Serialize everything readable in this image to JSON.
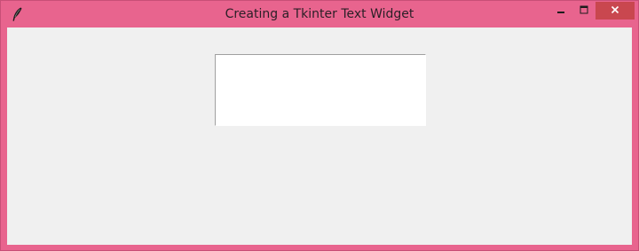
{
  "window": {
    "title": "Creating a Tkinter Text Widget",
    "icon": "tk-feather-icon",
    "accent_color": "#e8648e",
    "close_button_color": "#c9474f"
  },
  "controls": {
    "minimize_icon": "minimize-icon",
    "maximize_icon": "maximize-icon",
    "close_icon": "close-icon"
  },
  "client": {
    "background": "#f0f0f0",
    "text_widget": {
      "value": ""
    }
  }
}
